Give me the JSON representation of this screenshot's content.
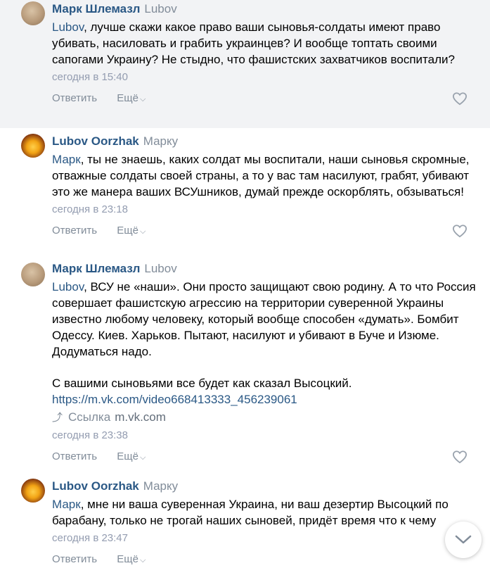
{
  "comments": [
    {
      "author": "Марк Шлемазл",
      "reply_to": "Lubov",
      "mention": "Lubov",
      "text": ", лучше скажи какое право ваши сыновья-солдаты имеют право убивать, насиловать и грабить украинцев? И вообще топтать своими сапогами Украину? Не стыдно, что фашистских захватчиков воспитали?",
      "time": "сегодня в 15:40",
      "reply_label": "Ответить",
      "more_label": "Ещё"
    },
    {
      "author": "Lubov Oorzhak",
      "reply_to": "Марку",
      "mention": "Марк",
      "text": ", ты не знаешь, каких солдат мы воспитали, наши сыновья скромные, отважные солдаты своей страны, а то у вас там насилуют, грабят, убивают это же манера ваших ВСУшников, думай прежде оскорблять, обзываться!",
      "time": "сегодня в 23:18",
      "reply_label": "Ответить",
      "more_label": "Ещё"
    },
    {
      "author": "Марк Шлемазл",
      "reply_to": "Lubov",
      "mention": "Lubov",
      "text": ", ВСУ не «наши». Они просто защищают свою родину. А то что Россия совершает фашистскую агрессию на территории суверенной Украины известно любому человеку, который вообще способен «думать». Бомбит Одессу. Киев. Харьков. Пытают, насилуют и убивают в Буче и Изюме. Додуматься надо.",
      "text2": "С вашими сыновьями все будет как сказал Высоцкий.",
      "link": "https://m.vk.com/video668413333_456239061",
      "attachment_label": "Ссылка",
      "attachment_domain": "m.vk.com",
      "time": "сегодня в 23:38",
      "reply_label": "Ответить",
      "more_label": "Ещё"
    },
    {
      "author": "Lubov Oorzhak",
      "reply_to": "Марку",
      "mention": "Марк",
      "text": ", мне ни ваша суверенная Украина, ни ваш дезертир Высоцкий по барабану, только не трогай наших сыновей, придёт время что к чему",
      "time": "сегодня в 23:47",
      "reply_label": "Ответить",
      "more_label": "Ещё"
    }
  ],
  "icons": {
    "like": "heart-outline-icon",
    "more": "chevron-down-icon",
    "link": "share-arrow-icon",
    "scroll": "chevron-down-icon"
  },
  "colors": {
    "author": "#2a5885",
    "meta": "#939cb0",
    "highlight_bg": "#f2f3f5"
  }
}
